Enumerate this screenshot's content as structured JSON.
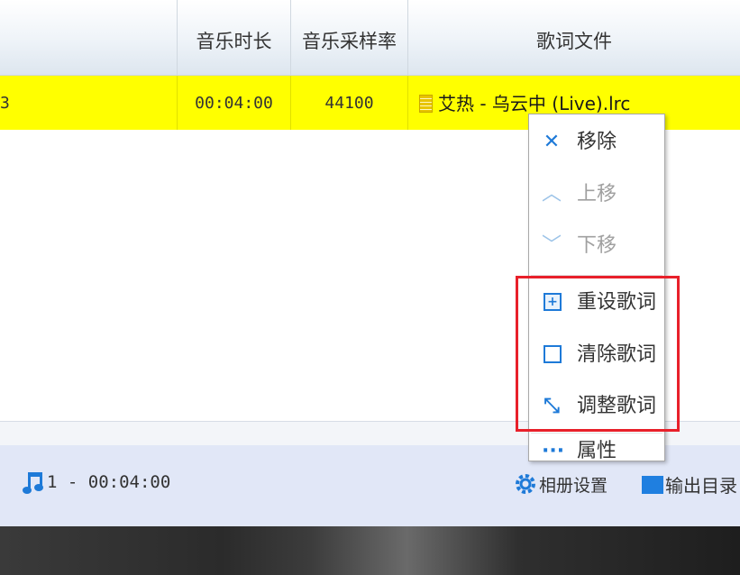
{
  "table": {
    "headers": {
      "duration": "音乐时长",
      "sample_rate": "音乐采样率",
      "lyrics_file": "歌词文件"
    },
    "selected_row": {
      "edge_fragment": "3",
      "duration": "00:04:00",
      "sample_rate": "44100",
      "lyrics_file": "艾热 - 乌云中 (Live).lrc"
    }
  },
  "context_menu": {
    "items": [
      {
        "label": "移除",
        "icon": "close-icon",
        "enabled": true
      },
      {
        "label": "上移",
        "icon": "chevron-up-icon",
        "enabled": false
      },
      {
        "label": "下移",
        "icon": "chevron-down-icon",
        "enabled": false
      },
      {
        "label": "重设歌词",
        "icon": "reset-lyrics-icon",
        "enabled": true
      },
      {
        "label": "清除歌词",
        "icon": "clear-lyrics-icon",
        "enabled": true
      },
      {
        "label": "调整歌词",
        "icon": "adjust-lyrics-icon",
        "enabled": true
      },
      {
        "label": "属性",
        "icon": "more-icon",
        "enabled": true
      }
    ]
  },
  "statusbar": {
    "track_summary": "1 - 00:04:00",
    "album_settings_label": "相册设置",
    "output_dir_label": "输出目录"
  },
  "colors": {
    "selected_row": "#ffff00",
    "accent": "#1e7ad8",
    "highlight_box": "#e8202a",
    "statusbar_bg": "#e1e7f7"
  }
}
